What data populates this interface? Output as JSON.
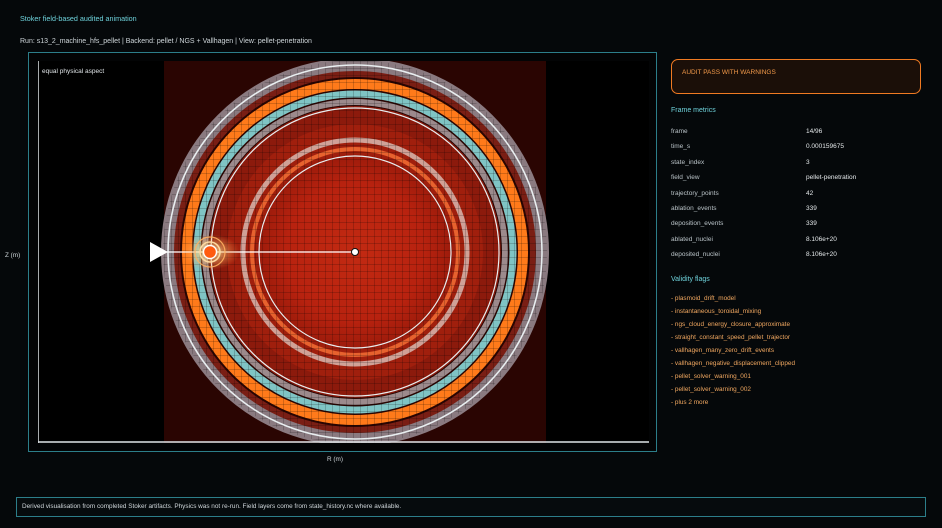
{
  "app": {
    "title": "Stoker field-based audited animation",
    "run_line": "Run: s13_2_machine_hfs_pellet | Backend: pellet / NGS + Vallhagen | View: pellet-penetration"
  },
  "plot": {
    "aspect_label": "equal physical aspect",
    "xlabel": "R (m)",
    "ylabel": "Z (m)",
    "colors": {
      "background": "#000000",
      "field_box": "#2a0502",
      "core": "#c62a12",
      "orange_band": "#ff7a1a",
      "teal_band": "#7fc4c4",
      "pellet": "#ff5a10",
      "trajectory": "#ffffff"
    },
    "pellet_progress": 0.46
  },
  "audit": {
    "status": "AUDIT PASS WITH WARNINGS",
    "accent": "#f07a22"
  },
  "metrics": {
    "title": "Frame metrics",
    "rows": [
      {
        "key": "frame",
        "value": "14/96"
      },
      {
        "key": "time_s",
        "value": "0.000159675"
      },
      {
        "key": "state_index",
        "value": "3"
      },
      {
        "key": "field_view",
        "value": "pellet-penetration"
      },
      {
        "key": "trajectory_points",
        "value": "42"
      },
      {
        "key": "ablation_events",
        "value": "339"
      },
      {
        "key": "deposition_events",
        "value": "339"
      },
      {
        "key": "ablated_nuclei",
        "value": "8.106e+20"
      },
      {
        "key": "deposited_nuclei",
        "value": "8.106e+20"
      }
    ]
  },
  "flags": {
    "title": "Validity flags",
    "items": [
      "- plasmoid_drift_model",
      "- instantaneous_toroidal_mixing",
      "- ngs_cloud_energy_closure_approximate",
      "- straight_constant_speed_pellet_trajector",
      "- vallhagen_many_zero_drift_events",
      "- vallhagen_negative_displacement_clipped",
      "- pellet_solver_warning_001",
      "- pellet_solver_warning_002",
      "- plus 2 more"
    ]
  },
  "footer": {
    "text": "Derived visualisation from completed Stoker artifacts. Physics was not re-run. Field layers come from state_history.nc where available."
  }
}
